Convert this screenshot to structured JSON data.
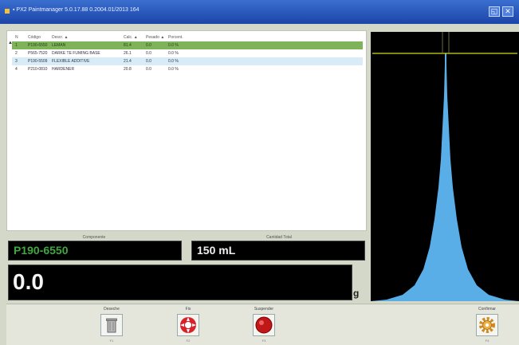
{
  "window": {
    "title": "▪ PX2 Paintmanager 5.0.17.88 0.2004.01/2013 164",
    "minimize_glyph": "◱",
    "close_glyph": "✕"
  },
  "table": {
    "headers": [
      "N",
      "Código",
      "Descr. ▲",
      "Calc. ▲",
      "Pesado ▲",
      "Porcent."
    ],
    "rows": [
      {
        "n": "1",
        "code": "P190-6550",
        "desc": "LEMAN",
        "calc": "81.4",
        "weighed": "0.0",
        "pct": "0.0 %"
      },
      {
        "n": "2",
        "code": "P565-7520",
        "desc": "DARKE TE FUMING BASE",
        "calc": "26.1",
        "weighed": "0.0",
        "pct": "0.0 %"
      },
      {
        "n": "3",
        "code": "P190-5509",
        "desc": "FLEXIBLE ADDITIVE",
        "calc": "21.4",
        "weighed": "0.0",
        "pct": "0.0 %"
      },
      {
        "n": "4",
        "code": "P210-0810",
        "desc": "HARDENER",
        "calc": "20.8",
        "weighed": "0.0",
        "pct": "0.0 %"
      }
    ]
  },
  "component": {
    "label": "Componente",
    "value": "P190-6550"
  },
  "quantity": {
    "label": "Cantidad Total",
    "value": "150 mL"
  },
  "weight": {
    "value": "0.0",
    "unit": "g"
  },
  "buttons": [
    {
      "id": "delete",
      "label": "Deseche",
      "sub": "F1",
      "icon": "trash-can-icon"
    },
    {
      "id": "fix",
      "label": "Fix",
      "sub": "F2",
      "icon": "lifebuoy-icon"
    },
    {
      "id": "suspend",
      "label": "Suspender",
      "sub": "F3",
      "icon": "stop-red-icon"
    },
    {
      "id": "confirm",
      "label": "Confirmar",
      "sub": "F4",
      "icon": "gear-icon"
    }
  ],
  "colors": {
    "selected_row": "#7fb35a",
    "alt_row": "#d7ecf6",
    "component_text": "#3fa83f",
    "chart_fill": "#5aaee8",
    "chart_target_line": "#d8d820"
  }
}
